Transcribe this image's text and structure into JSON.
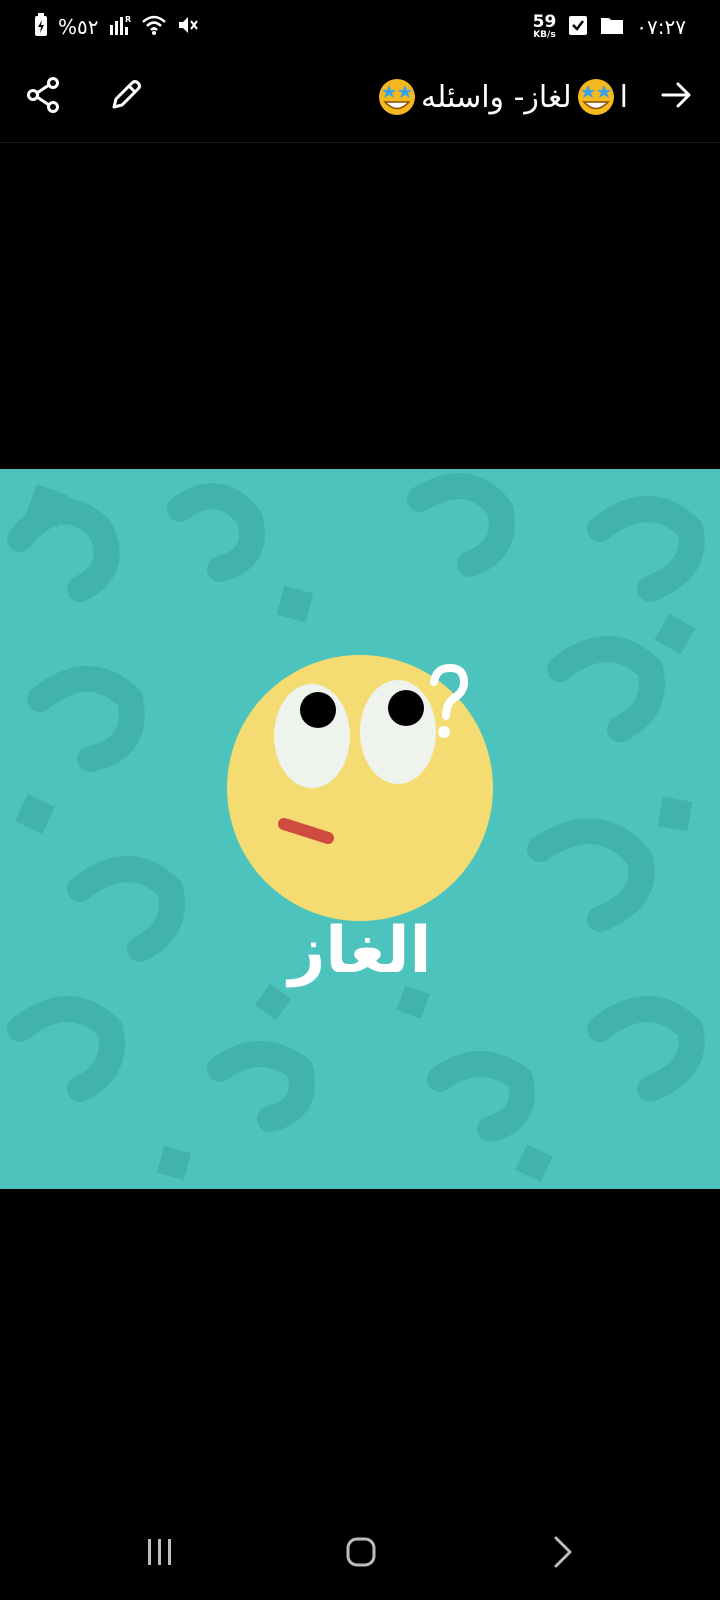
{
  "status_bar": {
    "time": "٠٧:٢٧",
    "battery": "%٥٢",
    "net_speed_value": "59",
    "net_speed_unit": "KB/s"
  },
  "app_bar": {
    "title_start": "ا",
    "title_main": "لغاز- واسئله",
    "title_emoji": "star-struck-emoji"
  },
  "image": {
    "caption": "الغاز",
    "background_color": "#4cc3bc",
    "face_color": "#f5dc72",
    "mouth_color": "#cf4a3f"
  },
  "icons": {
    "share": "share-icon",
    "edit": "pencil-icon",
    "back": "arrow-right-icon",
    "recents": "recents-icon",
    "home": "home-icon",
    "nav_back": "chevron-right-icon"
  }
}
